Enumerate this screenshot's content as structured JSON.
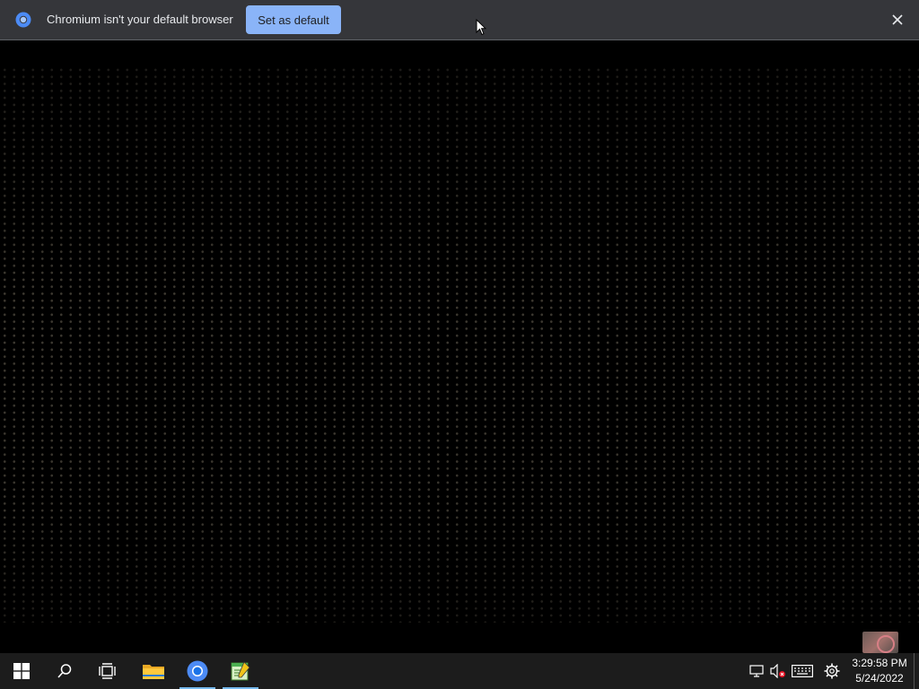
{
  "infobar": {
    "message": "Chromium isn't your default browser",
    "set_default_label": "Set as default",
    "icons": [
      "chromium-logo-icon",
      "close-icon"
    ]
  },
  "taskbar": {
    "items": [
      {
        "name": "start-button",
        "icon": "windows-logo-icon"
      },
      {
        "name": "search-button",
        "icon": "search-icon"
      },
      {
        "name": "task-view-button",
        "icon": "task-view-icon"
      },
      {
        "name": "file-explorer-button",
        "icon": "folder-icon"
      },
      {
        "name": "chromium-taskbar-button",
        "icon": "chromium-icon",
        "active": true
      },
      {
        "name": "notepad-taskbar-button",
        "icon": "notepad-icon",
        "active": true
      }
    ],
    "tray": {
      "icons": [
        "network-icon",
        "volume-muted-icon",
        "keyboard-icon",
        "settings-gear-icon"
      ],
      "time": "3:29:58 PM",
      "date": "5/24/2022"
    }
  },
  "colors": {
    "infobar_bg": "#35363a",
    "button_accent": "#8ab4f8",
    "taskbar_bg": "#1c1c1c",
    "active_indicator": "#76b9ed"
  }
}
